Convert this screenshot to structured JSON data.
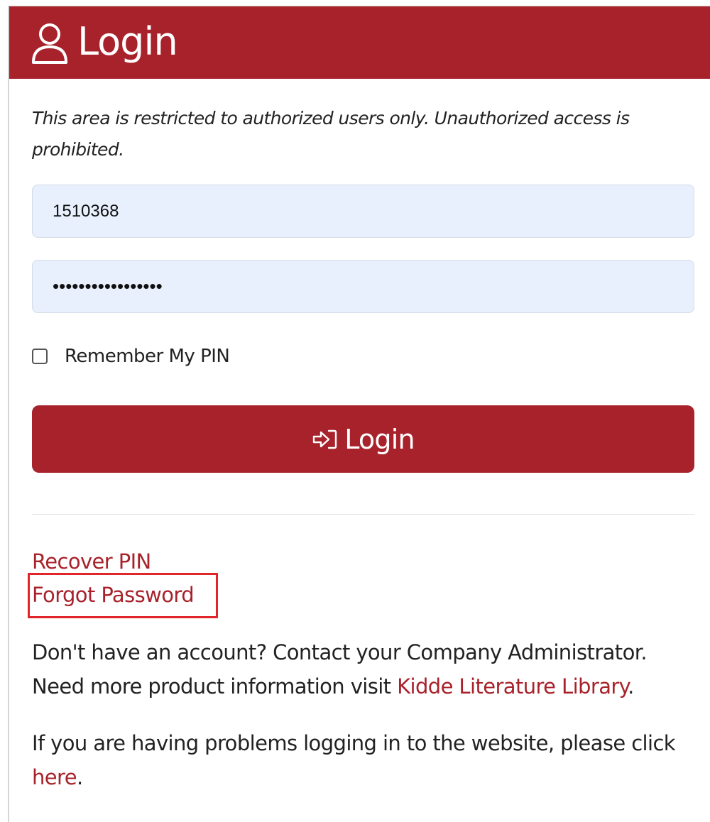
{
  "header": {
    "title": "Login",
    "icon": "user-icon",
    "color": "#a8222b"
  },
  "notice": "This area is restricted to authorized users only. Unauthorized access is prohibited.",
  "form": {
    "username_value": "1510368",
    "password_value": "•••••••••••••••••",
    "remember_label": "Remember My PIN",
    "remember_checked": false,
    "login_button_label": "Login",
    "login_button_icon": "sign-in-icon"
  },
  "links": {
    "recover_pin": "Recover PIN",
    "forgot_password": "Forgot Password"
  },
  "info": {
    "line1": "Don't have an account? Contact your Company Administrator.",
    "line2_prefix": "Need more product information visit ",
    "line2_link": "Kidde Literature Library",
    "line2_suffix": ".",
    "line3_prefix": "If you are having problems logging in to the website, please click ",
    "line3_link": "here",
    "line3_suffix": "."
  },
  "colors": {
    "accent": "#a8222b",
    "highlight_box": "#e0262b",
    "field_bg": "#e8f0fe"
  }
}
